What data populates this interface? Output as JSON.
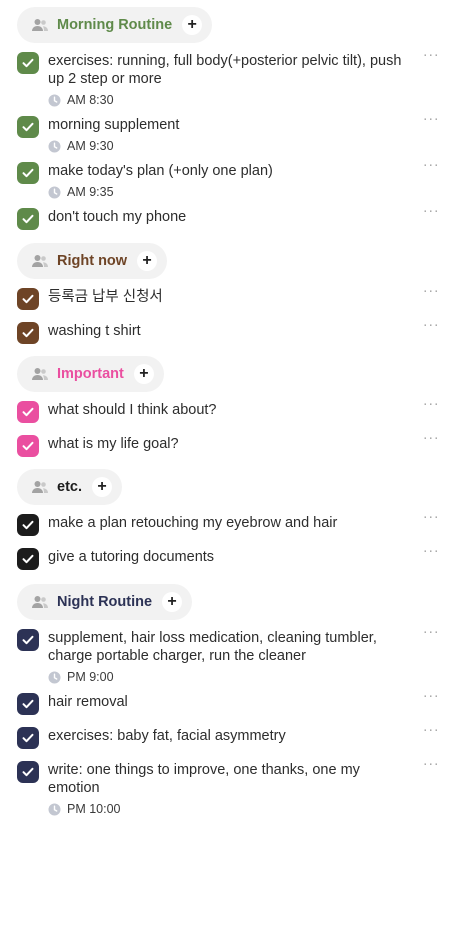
{
  "sections": [
    {
      "id": "morning",
      "title": "Morning Routine",
      "color": "#5f8a4a",
      "title_color": "#5f8a4a",
      "tasks": [
        {
          "text": "exercises: running, full body(+posterior pelvic tilt), push up 2 step or more",
          "time": "AM 8:30"
        },
        {
          "text": "morning supplement",
          "time": "AM 9:30"
        },
        {
          "text": "make today's plan (+only one plan)",
          "time": "AM 9:35"
        },
        {
          "text": "don't touch my phone",
          "time": ""
        }
      ]
    },
    {
      "id": "rightnow",
      "title": "Right now",
      "color": "#6e4426",
      "title_color": "#6e4426",
      "tasks": [
        {
          "text": "등록금 납부 신청서",
          "time": ""
        },
        {
          "text": "washing t shirt",
          "time": ""
        }
      ]
    },
    {
      "id": "important",
      "title": "Important",
      "color": "#ea4fa0",
      "title_color": "#ea4fa0",
      "tasks": [
        {
          "text": "what should I think about?",
          "time": ""
        },
        {
          "text": "what is my life goal?",
          "time": ""
        }
      ]
    },
    {
      "id": "etc",
      "title": "etc.",
      "color": "#1c1c1c",
      "title_color": "#1c1c1c",
      "tasks": [
        {
          "text": "make a plan retouching my eyebrow and hair",
          "time": ""
        },
        {
          "text": "give a tutoring documents",
          "time": ""
        }
      ]
    },
    {
      "id": "night",
      "title": "Night Routine",
      "color": "#2c3255",
      "title_color": "#2c3255",
      "tasks": [
        {
          "text": "supplement, hair loss medication, cleaning tumbler, charge portable charger, run the cleaner",
          "time": "PM 9:00"
        },
        {
          "text": "hair removal",
          "time": ""
        },
        {
          "text": "exercises: baby fat, facial asymmetry",
          "time": ""
        },
        {
          "text": "write: one things to improve, one thanks, one my emotion",
          "time": "PM 10:00"
        }
      ]
    }
  ],
  "icons": {
    "section": "people-icon",
    "add": "plus-icon",
    "check": "check-icon",
    "time": "clock-icon",
    "more": "more-horizontal-icon"
  },
  "labels": {
    "add": "+",
    "more": "···"
  }
}
